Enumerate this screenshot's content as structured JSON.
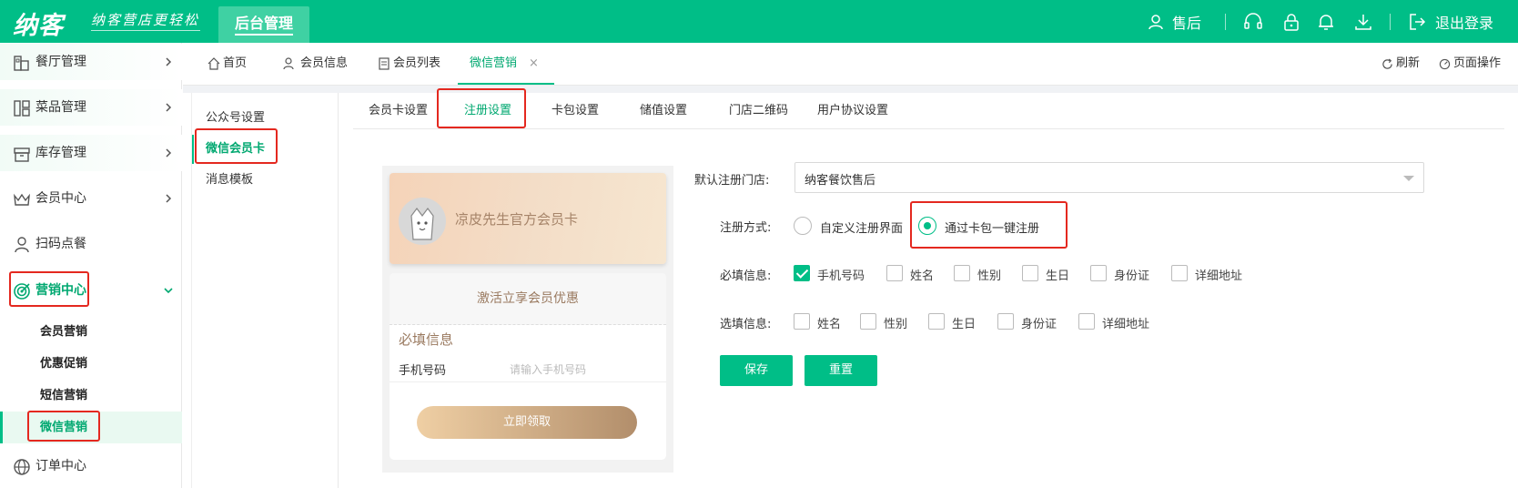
{
  "topbar": {
    "logo": "纳客",
    "slogan": "纳客营店更轻松",
    "admin_tab": "后台管理",
    "user": "售后",
    "logout": "退出登录",
    "icons": [
      "user-icon",
      "headset-icon",
      "lock-icon",
      "bell-icon",
      "download-icon",
      "logout-icon"
    ]
  },
  "sidebar": {
    "items": [
      {
        "label": "餐厅管理",
        "icon": "restaurant-icon"
      },
      {
        "label": "菜品管理",
        "icon": "dishes-icon"
      },
      {
        "label": "库存管理",
        "icon": "inventory-icon"
      },
      {
        "label": "会员中心",
        "icon": "crown-icon"
      },
      {
        "label": "扫码点餐",
        "icon": "person-icon"
      },
      {
        "label": "营销中心",
        "icon": "target-icon"
      }
    ],
    "sub_items": [
      {
        "label": "会员营销"
      },
      {
        "label": "优惠促销"
      },
      {
        "label": "短信营销"
      },
      {
        "label": "微信营销"
      }
    ],
    "bottom_item": {
      "label": "订单中心",
      "icon": "globe-icon"
    }
  },
  "tabs": [
    {
      "label": "首页",
      "icon": "home-icon"
    },
    {
      "label": "会员信息",
      "icon": "member-icon"
    },
    {
      "label": "会员列表",
      "icon": "list-icon"
    },
    {
      "label": "微信营销",
      "icon": ""
    }
  ],
  "tab_close": "×",
  "tab_actions": {
    "refresh": "刷新",
    "page_ops": "页面操作"
  },
  "inner_nav": [
    {
      "label": "公众号设置"
    },
    {
      "label": "微信会员卡"
    },
    {
      "label": "消息模板"
    }
  ],
  "subtabs": [
    "会员卡设置",
    "注册设置",
    "卡包设置",
    "储值设置",
    "门店二维码",
    "用户协议设置"
  ],
  "preview": {
    "card_title": "凉皮先生官方会员卡",
    "form_head": "激活立享会员优惠",
    "required_title": "必填信息",
    "phone_label": "手机号码",
    "phone_placeholder": "请输入手机号码",
    "claim_button": "立即领取"
  },
  "form": {
    "default_store_label": "默认注册门店:",
    "default_store_value": "纳客餐饮售后",
    "reg_method_label": "注册方式:",
    "reg_methods": [
      {
        "label": "自定义注册界面",
        "selected": false
      },
      {
        "label": "通过卡包一键注册",
        "selected": true
      }
    ],
    "required_label": "必填信息:",
    "required_fields": [
      {
        "label": "手机号码",
        "checked": true
      },
      {
        "label": "姓名",
        "checked": false
      },
      {
        "label": "性别",
        "checked": false
      },
      {
        "label": "生日",
        "checked": false
      },
      {
        "label": "身份证",
        "checked": false
      },
      {
        "label": "详细地址",
        "checked": false
      }
    ],
    "optional_label": "选填信息:",
    "optional_fields": [
      {
        "label": "姓名",
        "checked": false
      },
      {
        "label": "性别",
        "checked": false
      },
      {
        "label": "生日",
        "checked": false
      },
      {
        "label": "身份证",
        "checked": false
      },
      {
        "label": "详细地址",
        "checked": false
      }
    ],
    "save_button": "保存",
    "reset_button": "重置"
  },
  "colors": {
    "brand": "#00be87",
    "highlight_box": "#e4281f",
    "card_text": "#a68469"
  }
}
